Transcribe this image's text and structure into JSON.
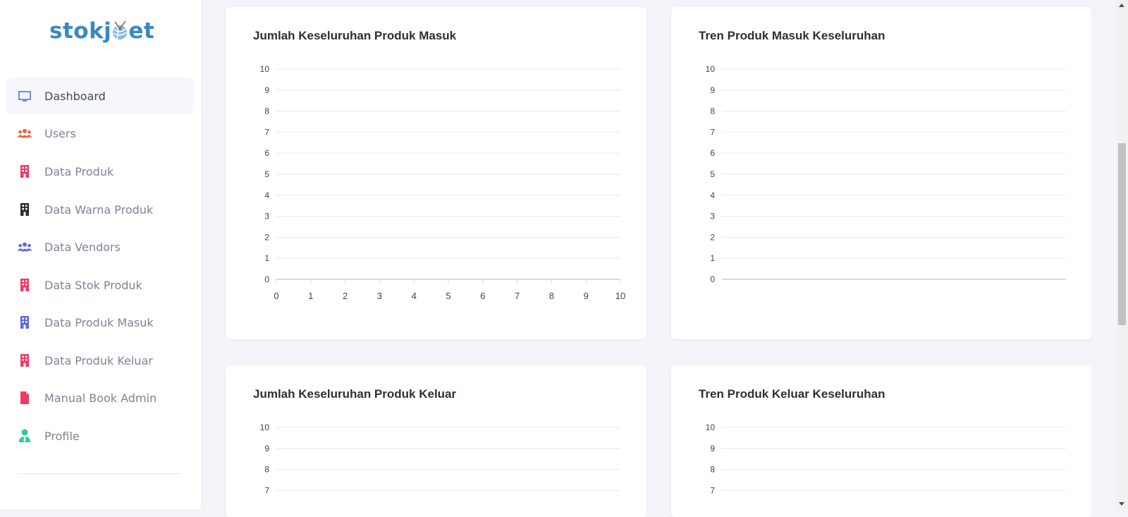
{
  "brand": {
    "name_part1": "stokj",
    "name_part2": "et"
  },
  "sidebar": {
    "items": [
      {
        "label": "Dashboard",
        "icon": "monitor-icon",
        "color": "#5a6fd8",
        "active": true
      },
      {
        "label": "Users",
        "icon": "users-icon",
        "color": "#f0643c"
      },
      {
        "label": "Data Produk",
        "icon": "building-icon",
        "color": "#ee3a64"
      },
      {
        "label": "Data Warna Produk",
        "icon": "building-icon",
        "color": "#2b2e36"
      },
      {
        "label": "Data Vendors",
        "icon": "users-icon",
        "color": "#5f6ad8"
      },
      {
        "label": "Data Stok Produk",
        "icon": "building-icon",
        "color": "#ee3a64"
      },
      {
        "label": "Data Produk Masuk",
        "icon": "building-icon",
        "color": "#5f6ad8"
      },
      {
        "label": "Data Produk Keluar",
        "icon": "building-icon",
        "color": "#ee3a64"
      },
      {
        "label": "Manual Book Admin",
        "icon": "file-icon",
        "color": "#ee3a64"
      },
      {
        "label": "Profile",
        "icon": "user-tie-icon",
        "color": "#2fcb8c"
      }
    ]
  },
  "cards": {
    "masuk_total": {
      "title": "Jumlah Keseluruhan Produk Masuk"
    },
    "masuk_trend": {
      "title": "Tren Produk Masuk Keseluruhan"
    },
    "keluar_total": {
      "title": "Jumlah Keseluruhan Produk Keluar"
    },
    "keluar_trend": {
      "title": "Tren Produk Keluar Keseluruhan"
    }
  },
  "chart_data": [
    {
      "type": "bar",
      "title": "Jumlah Keseluruhan Produk Masuk",
      "ylim": [
        0,
        10
      ],
      "yticks": [
        "0",
        "1",
        "2",
        "3",
        "4",
        "5",
        "6",
        "7",
        "8",
        "9",
        "10"
      ],
      "xlim": [
        0,
        10
      ],
      "xticks": [
        "0",
        "1",
        "2",
        "3",
        "4",
        "5",
        "6",
        "7",
        "8",
        "9",
        "10"
      ],
      "series": [],
      "grid": true
    },
    {
      "type": "line",
      "title": "Tren Produk Masuk Keseluruhan",
      "ylim": [
        0,
        10
      ],
      "yticks": [
        "0",
        "1",
        "2",
        "3",
        "4",
        "5",
        "6",
        "7",
        "8",
        "9",
        "10"
      ],
      "xticks": [],
      "series": [],
      "grid": true
    },
    {
      "type": "bar",
      "title": "Jumlah Keseluruhan Produk Keluar",
      "ylim": [
        0,
        10
      ],
      "yticks": [
        "7",
        "8",
        "9",
        "10"
      ],
      "series": [],
      "grid": true
    },
    {
      "type": "line",
      "title": "Tren Produk Keluar Keseluruhan",
      "ylim": [
        0,
        10
      ],
      "yticks": [
        "7",
        "8",
        "9",
        "10"
      ],
      "series": [],
      "grid": true
    }
  ]
}
